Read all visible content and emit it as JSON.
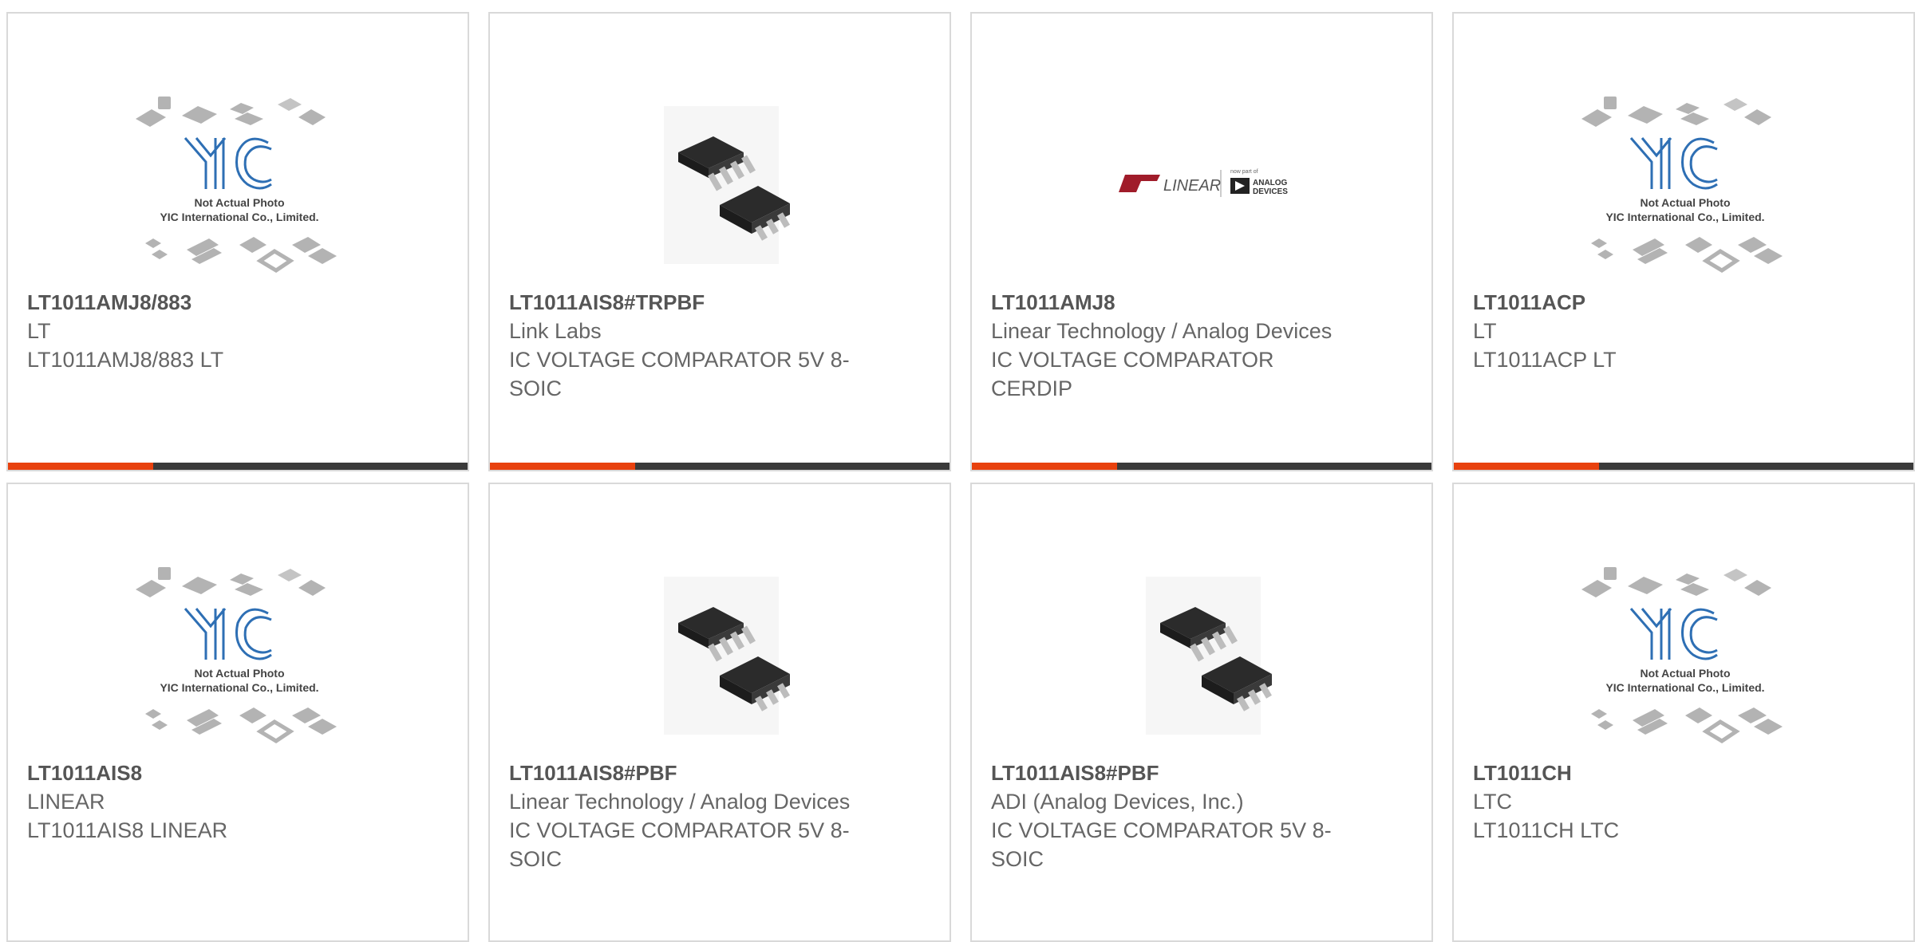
{
  "colors": {
    "accent": "#e8410e",
    "bar": "#3a3a3a",
    "border": "#d9d9d9",
    "yic_blue": "#2e6fb4"
  },
  "placeholder": {
    "line1": "Not Actual Photo",
    "line2": "YIC International Co., Limited."
  },
  "logo": {
    "left_word": "LINEAR",
    "right_word": "ANALOG DEVICES",
    "small_text": "now part of"
  },
  "cards": [
    {
      "part": "LT1011AMJ8/883",
      "brand": "LT",
      "desc": "LT1011AMJ8/883 LT",
      "image": "yic-placeholder"
    },
    {
      "part": "LT1011AIS8#TRPBF",
      "brand": "Link Labs",
      "desc": "IC VOLTAGE COMPARATOR 5V 8-SOIC",
      "image": "soic-chip"
    },
    {
      "part": "LT1011AMJ8",
      "brand": "Linear Technology / Analog Devices",
      "desc": "IC VOLTAGE COMPARATOR CERDIP",
      "image": "linear-adi-logo"
    },
    {
      "part": "LT1011ACP",
      "brand": "LT",
      "desc": "LT1011ACP LT",
      "image": "yic-placeholder"
    },
    {
      "part": "LT1011AIS8",
      "brand": "LINEAR",
      "desc": "LT1011AIS8 LINEAR",
      "image": "yic-placeholder"
    },
    {
      "part": "LT1011AIS8#PBF",
      "brand": "Linear Technology / Analog Devices",
      "desc": "IC VOLTAGE COMPARATOR 5V 8-SOIC",
      "image": "soic-chip"
    },
    {
      "part": "LT1011AIS8#PBF",
      "brand": "ADI (Analog Devices, Inc.)",
      "desc": "IC VOLTAGE COMPARATOR 5V 8-SOIC",
      "image": "soic-chip"
    },
    {
      "part": "LT1011CH",
      "brand": "LTC",
      "desc": "LT1011CH LTC",
      "image": "yic-placeholder"
    }
  ]
}
